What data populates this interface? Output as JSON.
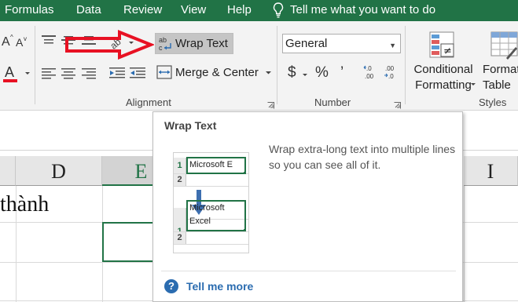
{
  "menu": {
    "items": [
      "Formulas",
      "Data",
      "Review",
      "View",
      "Help"
    ],
    "tell_me": "Tell me what you want to do"
  },
  "ribbon": {
    "alignment": {
      "wrap_text_label": "Wrap Text",
      "wrap_text_icon_text": "ab c",
      "merge_center_label": "Merge & Center",
      "group_label": "Alignment"
    },
    "number": {
      "format_value": "General",
      "currency_symbol": "$",
      "percent_symbol": "%",
      "comma_symbol": "’",
      "inc_decimal_text": "←.0 .00",
      "dec_decimal_text": ".00 →.0",
      "group_label": "Number"
    },
    "styles": {
      "conditional_formatting_line1": "Conditional",
      "conditional_formatting_line2": "Formatting",
      "format_table_line1": "Format",
      "format_table_line2": "Table",
      "group_label": "Styles"
    },
    "font": {
      "font_color_letter": "A",
      "font_color_accent": "#e81123"
    }
  },
  "grid": {
    "columns": [
      "D",
      "E",
      "I"
    ],
    "cell_text": "thành"
  },
  "tooltip": {
    "title": "Wrap Text",
    "description": "Wrap extra-long text into multiple lines so you can see all of it.",
    "preview": {
      "row1": "1",
      "row2": "2",
      "before_text": "Microsoft E",
      "after_line1": "Microsoft",
      "after_line2": "Excel"
    },
    "help_link": "Tell me more",
    "help_icon": "?"
  },
  "colors": {
    "excel_green": "#217346",
    "annotation_red": "#e81123",
    "link_blue": "#2b6cb0"
  }
}
